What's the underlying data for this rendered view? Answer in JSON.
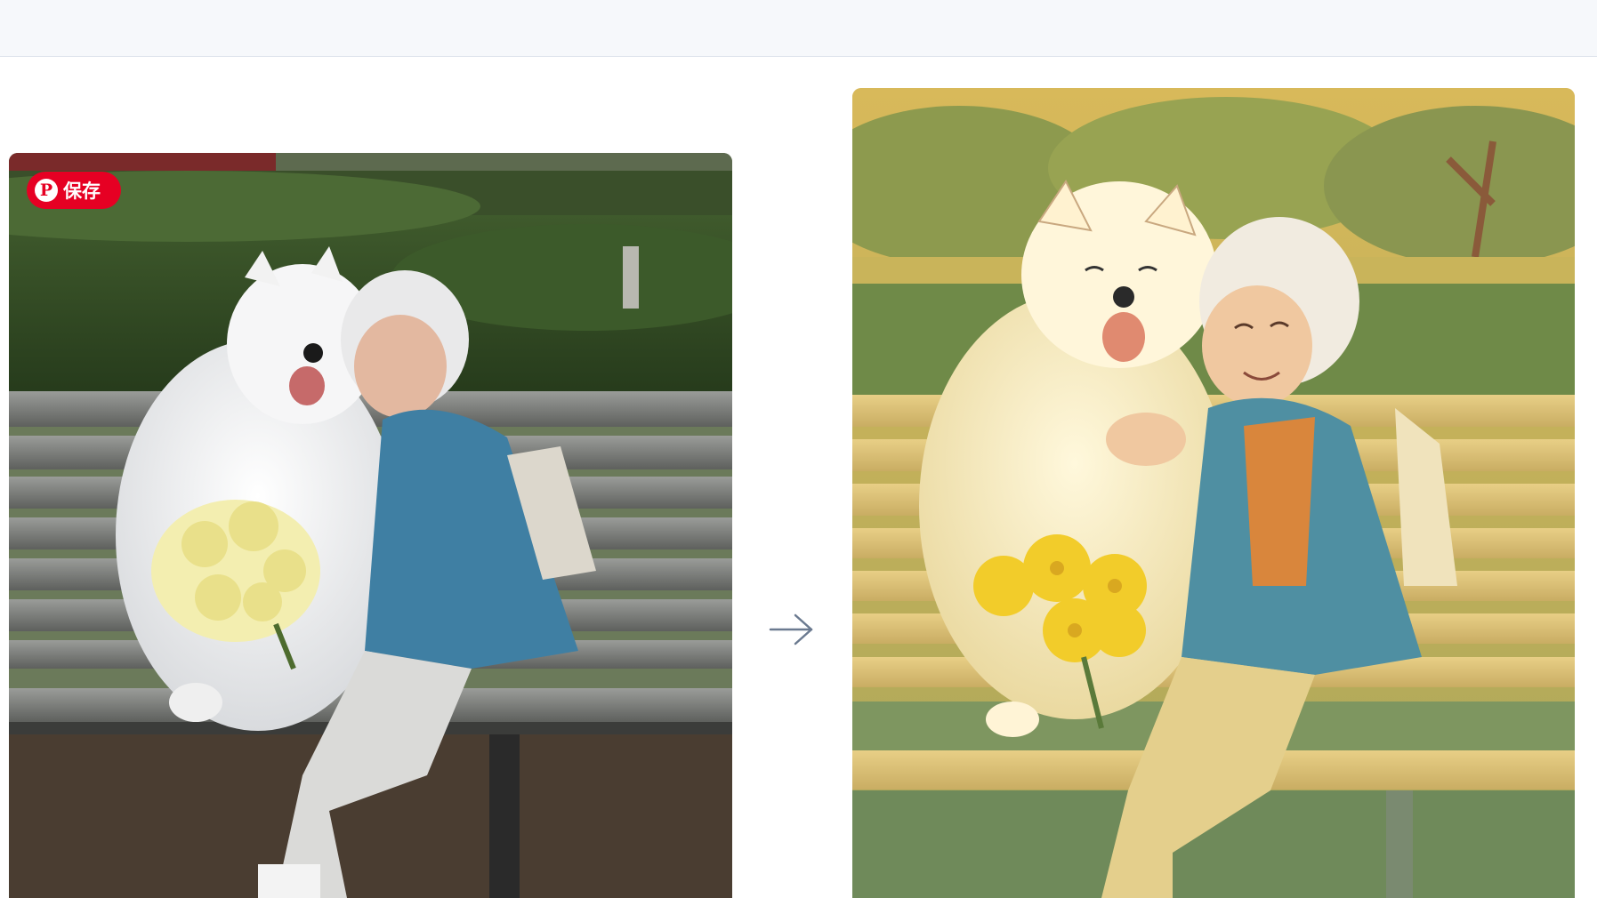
{
  "header": {},
  "left_image": {
    "save_button": {
      "label": "保存",
      "icon": "pinterest-icon",
      "color": "#e60023"
    }
  },
  "transform_arrow": {
    "icon": "arrow-right-icon",
    "color": "#6b7a90"
  },
  "right_image": {}
}
